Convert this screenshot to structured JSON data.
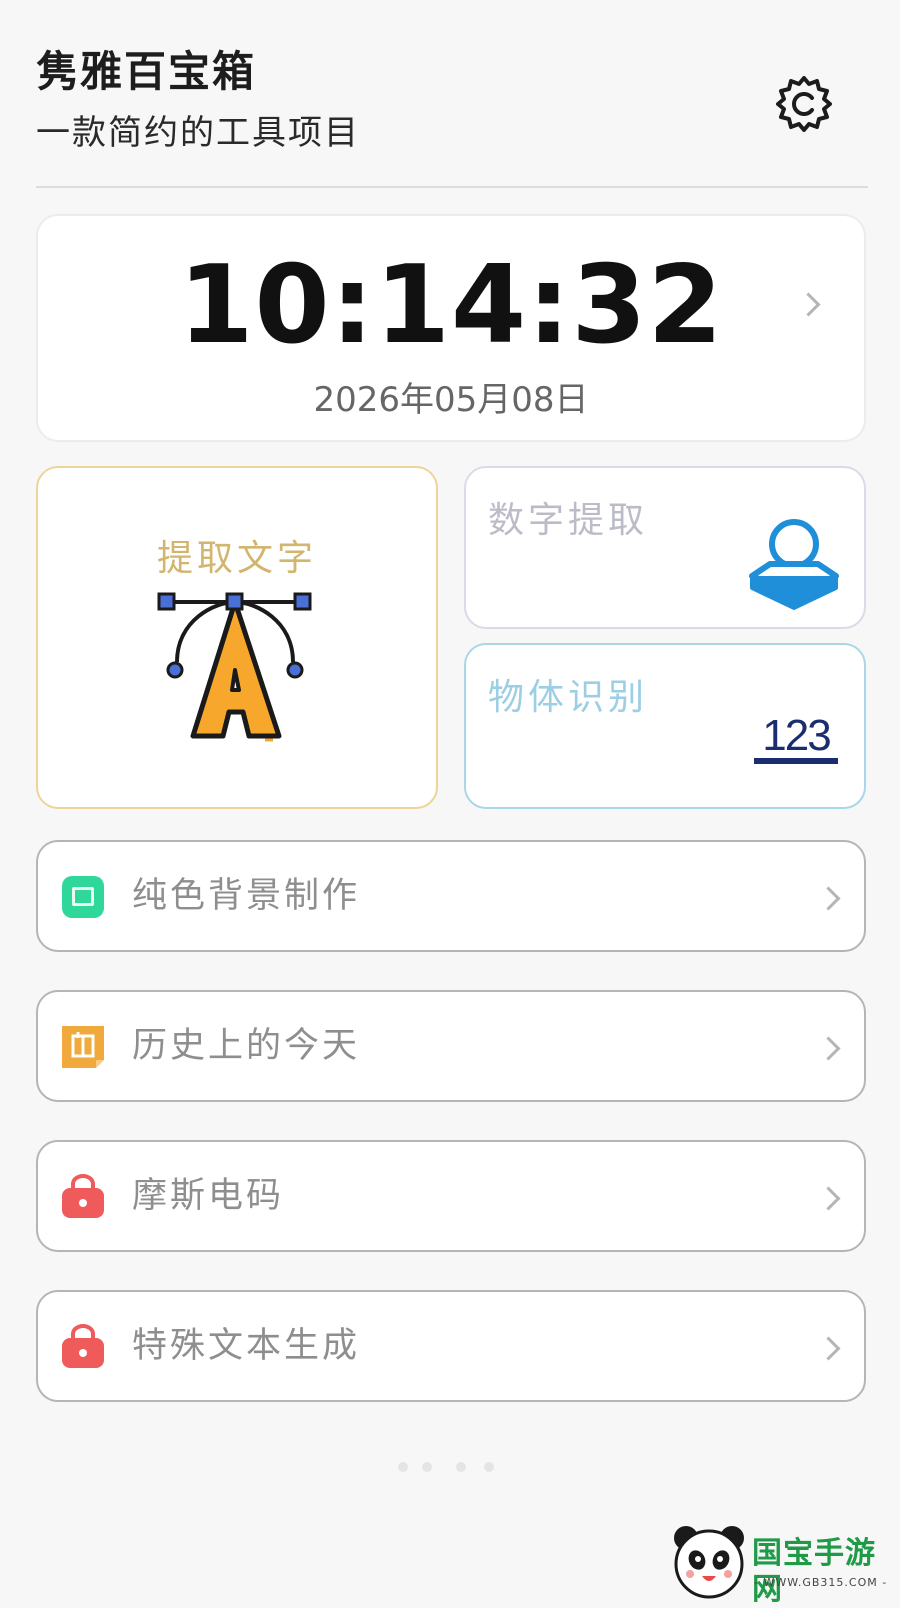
{
  "header": {
    "title": "隽雅百宝箱",
    "subtitle": "一款简约的工具项目",
    "settings_icon": "gear-icon"
  },
  "clock": {
    "time": "10:14:32",
    "date": "2026年05月08日"
  },
  "tiles": {
    "extract_text": {
      "label": "提取文字",
      "icon": "vector-letter-a-icon",
      "border_color": "#efd49a",
      "text_color": "#d2b56e"
    },
    "digit_extract": {
      "label": "数字提取",
      "icon": "stamp-icon",
      "border_color": "#d9dbe6",
      "text_color": "#bcbcc8"
    },
    "object_recognition": {
      "label": "物体识别",
      "icon": "numbers-123-icon",
      "icon_text": "123",
      "border_color": "#a9d6e8",
      "text_color": "#9ccee4"
    }
  },
  "list": {
    "items": [
      {
        "label": "纯色背景制作",
        "icon": "image-icon",
        "color": "#2fd89a"
      },
      {
        "label": "历史上的今天",
        "icon": "calendar-note-icon",
        "color": "#f2a93b"
      },
      {
        "label": "摩斯电码",
        "icon": "lock-bag-icon",
        "color": "#ef5a5a"
      },
      {
        "label": "特殊文本生成",
        "icon": "lock-bag-icon",
        "color": "#ef5a5a"
      }
    ]
  },
  "watermark": {
    "name": "国宝手游网",
    "url": "- WWW.GB315.COM -",
    "logo": "panda-logo"
  }
}
